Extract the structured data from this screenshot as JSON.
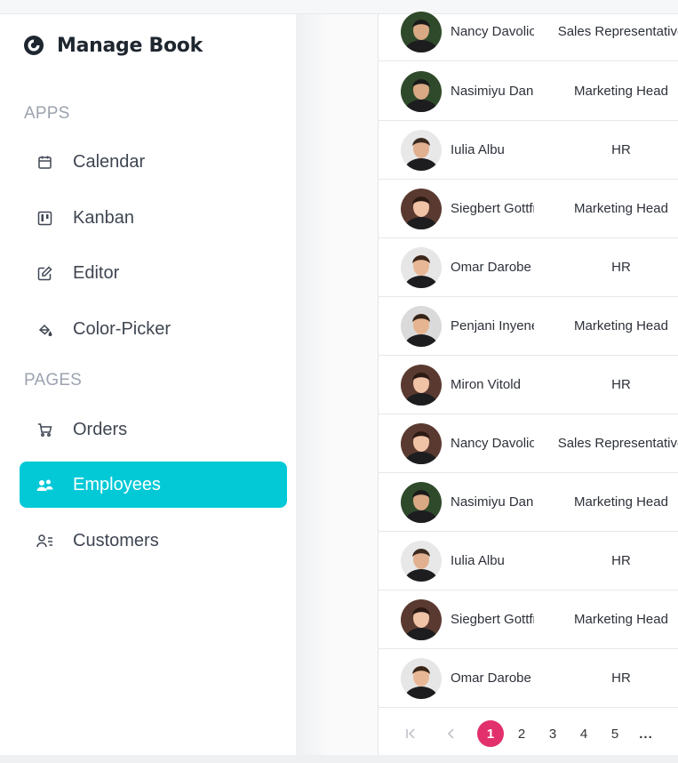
{
  "app": {
    "title": "Manage Book"
  },
  "sidebar": {
    "sections": [
      {
        "title": "APPS",
        "items": [
          {
            "label": "Calendar",
            "icon": "calendar-icon"
          },
          {
            "label": "Kanban",
            "icon": "kanban-icon"
          },
          {
            "label": "Editor",
            "icon": "editor-icon"
          },
          {
            "label": "Color-Picker",
            "icon": "color-picker-icon"
          }
        ]
      },
      {
        "title": "PAGES",
        "items": [
          {
            "label": "Orders",
            "icon": "cart-icon"
          },
          {
            "label": "Employees",
            "icon": "employees-icon",
            "active": true
          },
          {
            "label": "Customers",
            "icon": "customers-icon"
          }
        ]
      }
    ],
    "accent": "#03c9d7"
  },
  "employees": {
    "rows": [
      {
        "name": "Nancy Davolio",
        "designation": "Sales Representative"
      },
      {
        "name": "Nasimiyu Danai",
        "designation": "Marketing Head"
      },
      {
        "name": "Iulia Albu",
        "designation": "HR"
      },
      {
        "name": "Siegbert Gottfried",
        "designation": "Marketing Head"
      },
      {
        "name": "Omar Darobe",
        "designation": "HR"
      },
      {
        "name": "Penjani Inyene",
        "designation": "Marketing Head"
      },
      {
        "name": "Miron Vitold",
        "designation": "HR"
      },
      {
        "name": "Nancy Davolio",
        "designation": "Sales Representative"
      },
      {
        "name": "Nasimiyu Danai",
        "designation": "Marketing Head"
      },
      {
        "name": "Iulia Albu",
        "designation": "HR"
      },
      {
        "name": "Siegbert Gottfried",
        "designation": "Marketing Head"
      },
      {
        "name": "Omar Darobe",
        "designation": "HR"
      }
    ]
  },
  "pager": {
    "first_icon": "first-page-icon",
    "prev_icon": "prev-page-icon",
    "pages": [
      "1",
      "2",
      "3",
      "4",
      "5"
    ],
    "current": "1",
    "more": "...",
    "active_color": "#e1306c"
  }
}
